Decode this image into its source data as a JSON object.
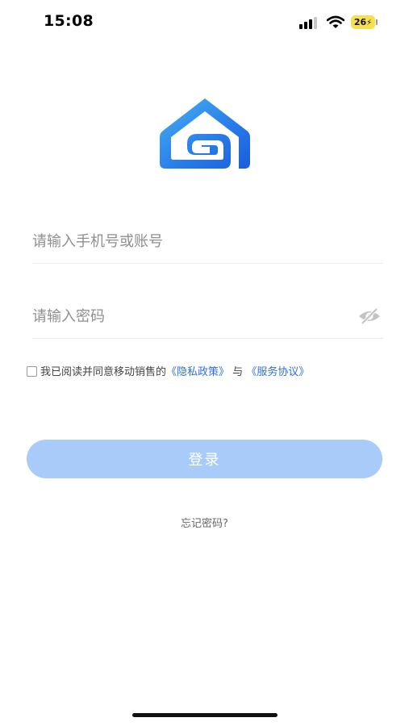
{
  "status_bar": {
    "time": "15:08",
    "battery_level": "26"
  },
  "login_form": {
    "account_placeholder": "请输入手机号或账号",
    "account_value": "",
    "password_placeholder": "请输入密码",
    "password_value": "",
    "password_visibility_icon": "eye-off-icon"
  },
  "agreement": {
    "checked": false,
    "prefix": "我已阅读并同意移动销售的",
    "privacy_policy_link": "《隐私政策》",
    "connector": "与",
    "service_agreement_link": "《服务协议》"
  },
  "actions": {
    "login_label": "登录",
    "forgot_password_label": "忘记密码?"
  },
  "theme": {
    "primary_color": "#1f6fe5",
    "login_button_disabled_color": "#a9cbfa",
    "link_color": "#2f6fe0",
    "logo_gradient_start": "#3aa9f2",
    "logo_gradient_end": "#1b5fe0"
  }
}
